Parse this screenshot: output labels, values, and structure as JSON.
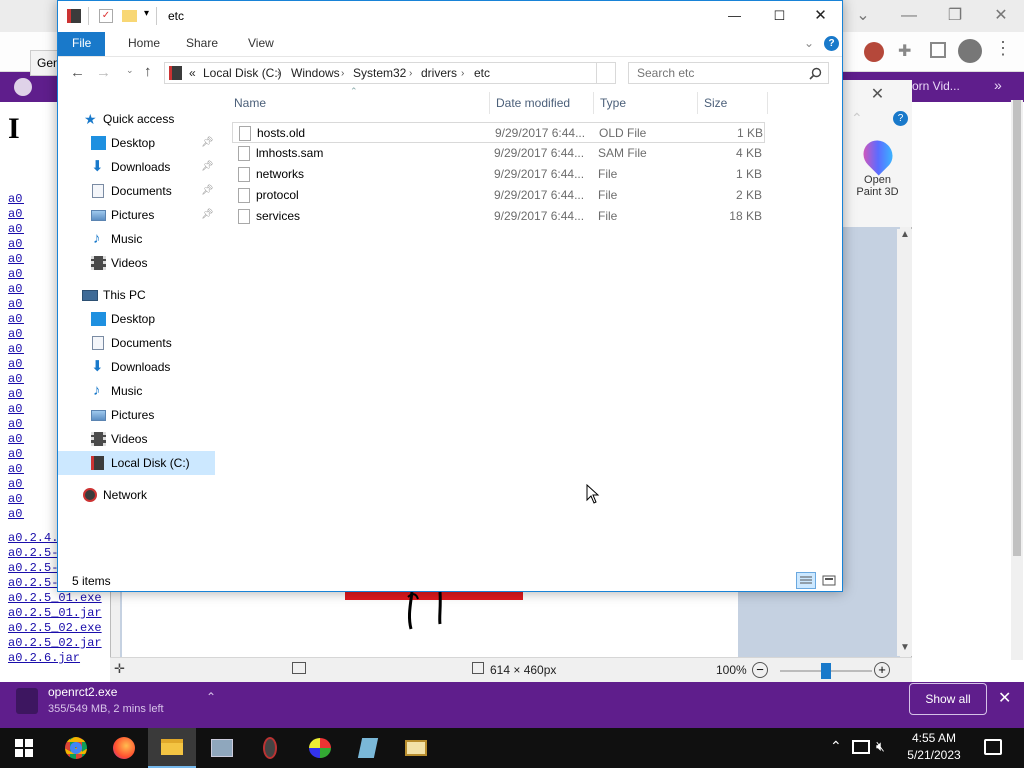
{
  "explorer": {
    "title": "etc",
    "ribbon_tabs": [
      "File",
      "Home",
      "Share",
      "View"
    ],
    "breadcrumb": [
      "«",
      "Local Disk (C:)",
      "Windows",
      "System32",
      "drivers",
      "etc"
    ],
    "search_placeholder": "Search etc",
    "columns": [
      "Name",
      "Date modified",
      "Type",
      "Size"
    ],
    "files": [
      {
        "name": "hosts.old",
        "date": "9/29/2017 6:44...",
        "type": "OLD File",
        "size": "1 KB"
      },
      {
        "name": "lmhosts.sam",
        "date": "9/29/2017 6:44...",
        "type": "SAM File",
        "size": "4 KB"
      },
      {
        "name": "networks",
        "date": "9/29/2017 6:44...",
        "type": "File",
        "size": "1 KB"
      },
      {
        "name": "protocol",
        "date": "9/29/2017 6:44...",
        "type": "File",
        "size": "2 KB"
      },
      {
        "name": "services",
        "date": "9/29/2017 6:44...",
        "type": "File",
        "size": "18 KB"
      }
    ],
    "status_items": "5 items",
    "nav": {
      "quick_access": "Quick access",
      "qa_desktop": "Desktop",
      "qa_downloads": "Downloads",
      "qa_documents": "Documents",
      "qa_pictures": "Pictures",
      "qa_music": "Music",
      "qa_videos": "Videos",
      "this_pc": "This PC",
      "pc_desktop": "Desktop",
      "pc_documents": "Documents",
      "pc_downloads": "Downloads",
      "pc_music": "Music",
      "pc_pictures": "Pictures",
      "pc_videos": "Videos",
      "local_disk": "Local Disk (C:)",
      "network": "Network"
    }
  },
  "paint": {
    "open_paint3d": "Open",
    "open_paint3d_line2": "Paint 3D",
    "dimensions": "614 × 460px",
    "zoom": "100%",
    "zoom_slider_fraction": 0.5
  },
  "browser": {
    "bookmark_text": "orn Vid...",
    "tab_fragment": "Gen",
    "heading_fragment": "I",
    "links": [
      "a0.2.4.",
      "a0.2.5-",
      "a0.2.5-",
      "a0.2.5-",
      "a0.2.5_01.exe",
      "a0.2.5_01.jar",
      "a0.2.5_02.exe",
      "a0.2.5_02.jar",
      "a0.2.6.jar"
    ]
  },
  "download": {
    "filename": "openrct2.exe",
    "status": "355/549 MB, 2 mins left",
    "show_all": "Show all"
  },
  "taskbar": {
    "time": "4:55 AM",
    "date": "5/21/2023"
  },
  "colors": {
    "accent": "#1979ca",
    "purple": "#5f1e8c",
    "selection": "#cce8ff"
  }
}
